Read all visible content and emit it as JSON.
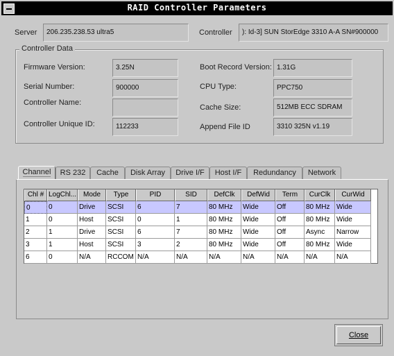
{
  "window": {
    "title": "RAID Controller Parameters",
    "menu_icon": "window-menu-icon"
  },
  "server": {
    "label": "Server",
    "value": "206.235.238.53 ultra5"
  },
  "controller": {
    "label": "Controller",
    "value": "): Id-3] SUN StorEdge 3310 A-A SN#900000"
  },
  "controller_data": {
    "title": "Controller Data",
    "firmware_label": "Firmware Version:",
    "firmware_value": "3.25N",
    "serial_label": "Serial Number:",
    "serial_value": "900000",
    "name_label": "Controller Name:",
    "name_value": "",
    "unique_label": "Controller Unique ID:",
    "unique_value": "112233",
    "boot_label": "Boot Record Version:",
    "boot_value": "1.31G",
    "cpu_label": "CPU Type:",
    "cpu_value": "PPC750",
    "cache_label": "Cache Size:",
    "cache_value": "512MB ECC SDRAM",
    "append_label": "Append File ID",
    "append_value": "3310 325N v1.19"
  },
  "tabs": [
    "Channel",
    "RS 232",
    "Cache",
    "Disk Array",
    "Drive I/F",
    "Host I/F",
    "Redundancy",
    "Network"
  ],
  "active_tab": "Channel",
  "table": {
    "columns": [
      "Chl #",
      "LogChl...",
      "Mode",
      "Type",
      "PID",
      "SID",
      "DefClk",
      "DefWid",
      "Term",
      "CurClk",
      "CurWid"
    ],
    "rows": [
      [
        "0",
        "0",
        "Drive",
        "SCSI",
        "6",
        "7",
        "80 MHz",
        "Wide",
        "Off",
        "80 MHz",
        "Wide"
      ],
      [
        "1",
        "0",
        "Host",
        "SCSI",
        "0",
        "1",
        "80 MHz",
        "Wide",
        "Off",
        "80 MHz",
        "Wide"
      ],
      [
        "2",
        "1",
        "Drive",
        "SCSI",
        "6",
        "7",
        "80 MHz",
        "Wide",
        "Off",
        "Async",
        "Narrow"
      ],
      [
        "3",
        "1",
        "Host",
        "SCSI",
        "3",
        "2",
        "80 MHz",
        "Wide",
        "Off",
        "80 MHz",
        "Wide"
      ],
      [
        "6",
        "0",
        "N/A",
        "RCCOM",
        "N/A",
        "N/A",
        "N/A",
        "N/A",
        "N/A",
        "N/A",
        "N/A"
      ]
    ],
    "selected_row": 0
  },
  "close_button": "Close",
  "colors": {
    "selection": "#c8c8ff",
    "window_bg": "#c9c9c9",
    "titlebar": "#000000"
  }
}
